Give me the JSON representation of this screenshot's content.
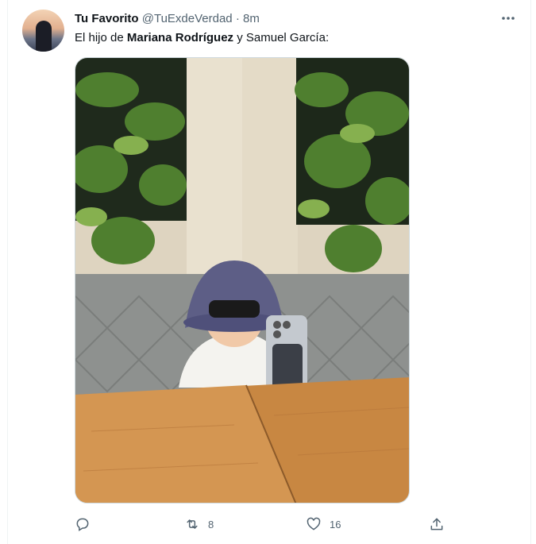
{
  "tweet": {
    "author_name": "Tu Favorito",
    "handle": "@TuExdeVerdad",
    "separator": "·",
    "time": "8m",
    "text_prefix": "El hijo de ",
    "text_bold": "Mariana Rodríguez",
    "text_suffix": " y Samuel García:",
    "media_description": "photo",
    "actions": {
      "reply_count": "",
      "retweet_count": "8",
      "like_count": "16",
      "share_count": ""
    }
  },
  "icons": {
    "more": "more-horizontal-icon",
    "reply": "reply-icon",
    "retweet": "retweet-icon",
    "like": "heart-icon",
    "share": "share-icon"
  },
  "colors": {
    "text_primary": "#0f1419",
    "text_secondary": "#536471",
    "border": "#cfd9de"
  }
}
